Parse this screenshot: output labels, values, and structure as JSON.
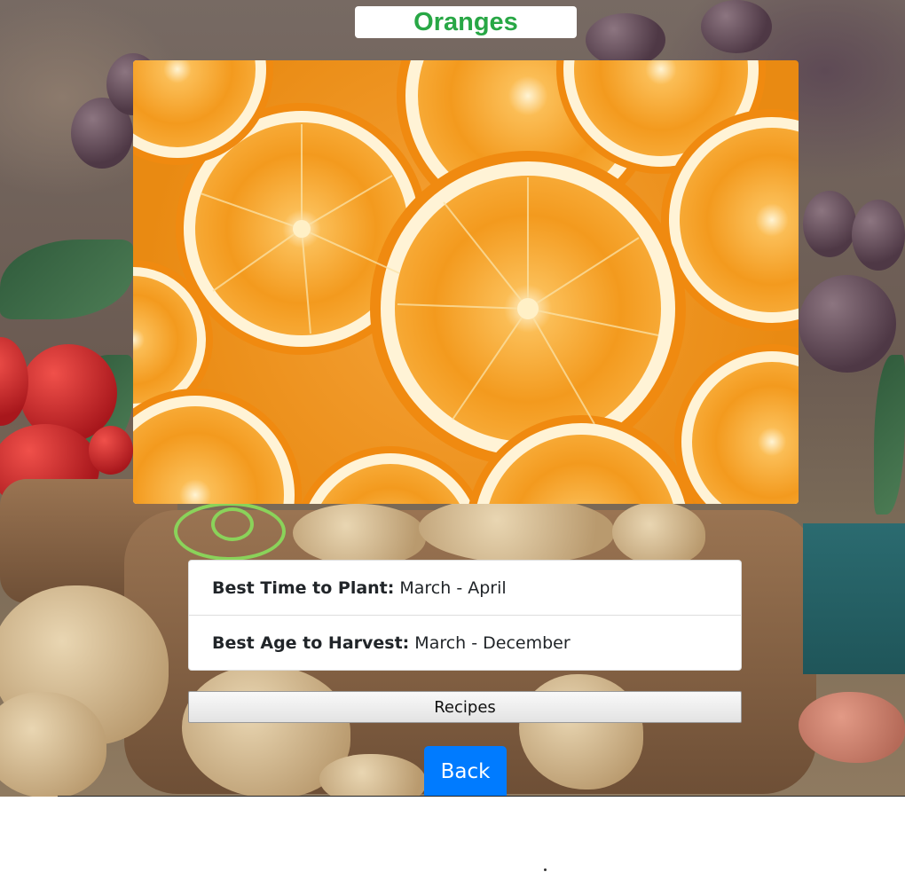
{
  "page": {
    "title": "Oranges"
  },
  "hero": {
    "subject": "sliced oranges"
  },
  "info": {
    "plant_label": "Best Time to Plant:",
    "plant_value": "March - April",
    "harvest_label": "Best Age to Harvest:",
    "harvest_value": "March - December"
  },
  "buttons": {
    "recipes_label": "Recipes",
    "back_label": "Back"
  },
  "colors": {
    "title": "#28a745",
    "back_button": "#007bff"
  }
}
